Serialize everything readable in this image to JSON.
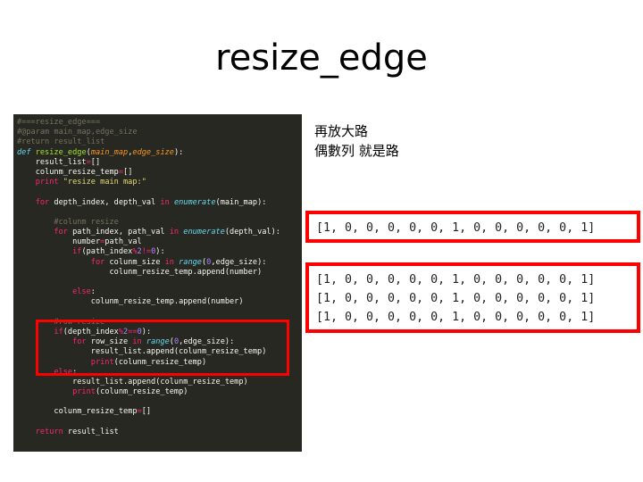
{
  "slide": {
    "title": "resize_edge"
  },
  "note": {
    "line1": "再放大路",
    "line2": "偶數列 就是路"
  },
  "code": {
    "lines": [
      [
        {
          "t": "#===resize_edge===",
          "c": "comment"
        }
      ],
      [
        {
          "t": "#@param main_map,edge_size",
          "c": "comment"
        }
      ],
      [
        {
          "t": "#return result_list",
          "c": "comment"
        }
      ],
      [
        {
          "t": "def ",
          "c": "kw"
        },
        {
          "t": "resize_edge",
          "c": "fn"
        },
        {
          "t": "(",
          "c": "plain"
        },
        {
          "t": "main_map",
          "c": "param"
        },
        {
          "t": ",",
          "c": "plain"
        },
        {
          "t": "edge_size",
          "c": "param"
        },
        {
          "t": "):",
          "c": "plain"
        }
      ],
      [
        {
          "t": "    result_list",
          "c": "plain"
        },
        {
          "t": "=",
          "c": "kw2"
        },
        {
          "t": "[]",
          "c": "plain"
        }
      ],
      [
        {
          "t": "    colunm_resize_temp",
          "c": "plain"
        },
        {
          "t": "=",
          "c": "kw2"
        },
        {
          "t": "[]",
          "c": "plain"
        }
      ],
      [
        {
          "t": "    print ",
          "c": "kw2"
        },
        {
          "t": "\"resize main map:\"",
          "c": "str"
        }
      ],
      [],
      [
        {
          "t": "    for ",
          "c": "kw2"
        },
        {
          "t": "depth_index, depth_val ",
          "c": "plain"
        },
        {
          "t": "in ",
          "c": "kw2"
        },
        {
          "t": "enumerate",
          "c": "kw"
        },
        {
          "t": "(main_map):",
          "c": "plain"
        }
      ],
      [],
      [
        {
          "t": "        #colunm resize",
          "c": "comment"
        }
      ],
      [
        {
          "t": "        for ",
          "c": "kw2"
        },
        {
          "t": "path_index, path_val ",
          "c": "plain"
        },
        {
          "t": "in ",
          "c": "kw2"
        },
        {
          "t": "enumerate",
          "c": "kw"
        },
        {
          "t": "(depth_val):",
          "c": "plain"
        }
      ],
      [
        {
          "t": "            number",
          "c": "plain"
        },
        {
          "t": "=",
          "c": "kw2"
        },
        {
          "t": "path_val",
          "c": "plain"
        }
      ],
      [
        {
          "t": "            if",
          "c": "kw2"
        },
        {
          "t": "(path_index",
          "c": "plain"
        },
        {
          "t": "%",
          "c": "kw2"
        },
        {
          "t": "2",
          "c": "num"
        },
        {
          "t": "!=",
          "c": "kw2"
        },
        {
          "t": "0",
          "c": "num"
        },
        {
          "t": "):",
          "c": "plain"
        }
      ],
      [
        {
          "t": "                for ",
          "c": "kw2"
        },
        {
          "t": "colunm_size ",
          "c": "plain"
        },
        {
          "t": "in ",
          "c": "kw2"
        },
        {
          "t": "range",
          "c": "kw"
        },
        {
          "t": "(",
          "c": "plain"
        },
        {
          "t": "0",
          "c": "num"
        },
        {
          "t": ",edge_size):",
          "c": "plain"
        }
      ],
      [
        {
          "t": "                    colunm_resize_temp.append(number)",
          "c": "plain"
        }
      ],
      [],
      [
        {
          "t": "            else",
          "c": "kw2"
        },
        {
          "t": ":",
          "c": "plain"
        }
      ],
      [
        {
          "t": "                colunm_resize_temp.append(number)",
          "c": "plain"
        }
      ],
      [],
      [
        {
          "t": "        #row resize",
          "c": "comment"
        }
      ],
      [
        {
          "t": "        if",
          "c": "kw2"
        },
        {
          "t": "(depth_index",
          "c": "plain"
        },
        {
          "t": "%",
          "c": "kw2"
        },
        {
          "t": "2",
          "c": "num"
        },
        {
          "t": "==",
          "c": "kw2"
        },
        {
          "t": "0",
          "c": "num"
        },
        {
          "t": "):",
          "c": "plain"
        }
      ],
      [
        {
          "t": "            for ",
          "c": "kw2"
        },
        {
          "t": "row_size ",
          "c": "plain"
        },
        {
          "t": "in ",
          "c": "kw2"
        },
        {
          "t": "range",
          "c": "kw"
        },
        {
          "t": "(",
          "c": "plain"
        },
        {
          "t": "0",
          "c": "num"
        },
        {
          "t": ",edge_size):",
          "c": "plain"
        }
      ],
      [
        {
          "t": "                result_list.append(colunm_resize_temp)",
          "c": "plain"
        }
      ],
      [
        {
          "t": "                print",
          "c": "kw2"
        },
        {
          "t": "(colunm_resize_temp)",
          "c": "plain"
        }
      ],
      [
        {
          "t": "        else",
          "c": "kw2"
        },
        {
          "t": ":",
          "c": "plain"
        }
      ],
      [
        {
          "t": "            result_list.append(colunm_resize_temp)",
          "c": "plain"
        }
      ],
      [
        {
          "t": "            print",
          "c": "kw2"
        },
        {
          "t": "(colunm_resize_temp)",
          "c": "plain"
        }
      ],
      [],
      [
        {
          "t": "        colunm_resize_temp",
          "c": "plain"
        },
        {
          "t": "=",
          "c": "kw2"
        },
        {
          "t": "[]",
          "c": "plain"
        }
      ],
      [],
      [
        {
          "t": "    return ",
          "c": "kw2"
        },
        {
          "t": "result_list",
          "c": "plain"
        }
      ]
    ]
  },
  "output_single": {
    "lines": [
      "[1, 0, 0, 0, 0, 0, 1, 0, 0, 0, 0, 0, 1]"
    ]
  },
  "output_triple": {
    "lines": [
      "[1, 0, 0, 0, 0, 0, 1, 0, 0, 0, 0, 0, 1]",
      "[1, 0, 0, 0, 0, 0, 1, 0, 0, 0, 0, 0, 1]",
      "[1, 0, 0, 0, 0, 0, 1, 0, 0, 0, 0, 0, 1]"
    ]
  },
  "colors": {
    "highlight": "#ff0000",
    "code_background": "#272822"
  }
}
